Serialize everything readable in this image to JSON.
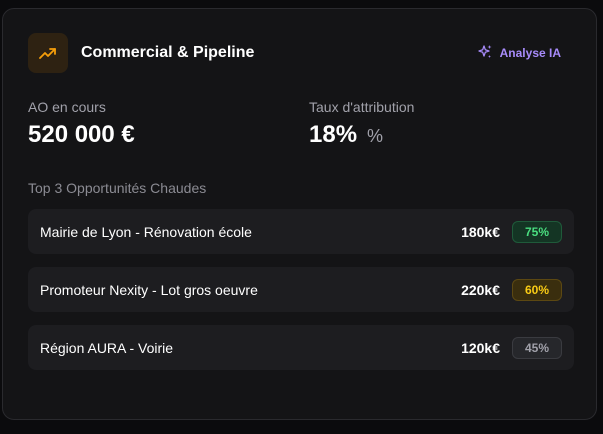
{
  "header": {
    "title": "Commercial & Pipeline",
    "icon": "trending-up-icon",
    "ai_button_label": "Analyse IA",
    "ai_icon": "sparkles-icon",
    "accent_color": "#f59e0b",
    "ai_color": "#a78bfa"
  },
  "metrics": {
    "ao": {
      "label": "AO en cours",
      "value": "520 000 €"
    },
    "taux": {
      "label": "Taux d'attribution",
      "value": "18%",
      "unit": "%"
    }
  },
  "opportunities": {
    "title": "Top 3 Opportunités Chaudes",
    "items": [
      {
        "name": "Mairie de Lyon - Rénovation école",
        "amount": "180k€",
        "probability": "75%",
        "badge_bg": "#143524",
        "badge_fg": "#4ade80",
        "badge_border": "#1f5a3a"
      },
      {
        "name": "Promoteur Nexity - Lot gros oeuvre",
        "amount": "220k€",
        "probability": "60%",
        "badge_bg": "#3a2e0e",
        "badge_fg": "#facc15",
        "badge_border": "#5c4812"
      },
      {
        "name": "Région AURA - Voirie",
        "amount": "120k€",
        "probability": "45%",
        "badge_bg": "#26272b",
        "badge_fg": "#a1a1aa",
        "badge_border": "#3a3b40"
      }
    ]
  }
}
